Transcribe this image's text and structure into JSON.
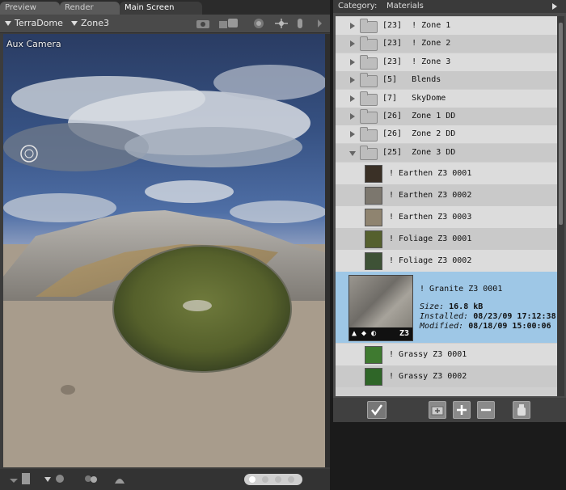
{
  "tabs": {
    "preview": "Preview",
    "render": "Render",
    "main": "Main Screen"
  },
  "viewport_toolbar": {
    "scene_dropdown": "TerraDome",
    "zone_dropdown": "Zone3"
  },
  "viewport": {
    "camera_label": "Aux Camera"
  },
  "library": {
    "category_label": "Category:",
    "category_value": "Materials",
    "folders": [
      {
        "label": "[23]  ! Zone 1",
        "expanded": false
      },
      {
        "label": "[23]  ! Zone 2",
        "expanded": false
      },
      {
        "label": "[23]  ! Zone 3",
        "expanded": false
      },
      {
        "label": "[5]   Blends",
        "expanded": false
      },
      {
        "label": "[7]   SkyDome",
        "expanded": false
      },
      {
        "label": "[26]  Zone 1 DD",
        "expanded": false
      },
      {
        "label": "[26]  Zone 2 DD",
        "expanded": false
      },
      {
        "label": "[25]  Zone 3 DD",
        "expanded": true
      }
    ],
    "materials_before": [
      {
        "label": "! Earthen Z3 0001",
        "thumb": "#3a3026"
      },
      {
        "label": "! Earthen Z3 0002",
        "thumb": "#7c776e"
      },
      {
        "label": "! Earthen Z3 0003",
        "thumb": "#8f8470"
      },
      {
        "label": "! Foliage Z3 0001",
        "thumb": "#55602e"
      },
      {
        "label": "! Foliage Z3 0002",
        "thumb": "#3e5236"
      }
    ],
    "selected": {
      "label": "! Granite Z3 0001",
      "size_label": "Size:",
      "size_value": "16.8 kB",
      "installed_label": "Installed:",
      "installed_value": "08/23/09 17:12:38",
      "modified_label": "Modified:",
      "modified_value": "08/18/09 15:00:06",
      "badge": "Z3"
    },
    "materials_after": [
      {
        "label": "! Grassy Z3 0001",
        "thumb": "#3f7a30"
      },
      {
        "label": "! Grassy Z3 0002",
        "thumb": "#2f6628"
      }
    ]
  },
  "colors": {
    "selected_row": "#9ec7e6",
    "panel_bg": "#3c3c3c"
  }
}
